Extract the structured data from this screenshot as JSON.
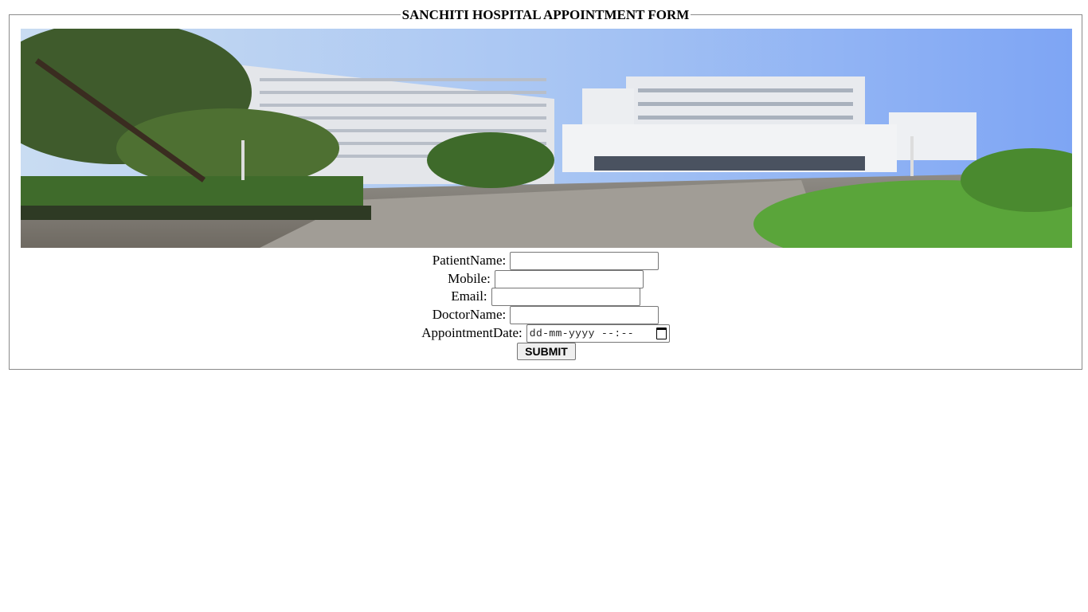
{
  "form": {
    "title": "SANCHITI HOSPITAL APPOINTMENT FORM",
    "fields": [
      {
        "label": "PatientName:",
        "value": ""
      },
      {
        "label": "Mobile:",
        "value": ""
      },
      {
        "label": "Email:",
        "value": ""
      },
      {
        "label": "DoctorName:",
        "value": ""
      },
      {
        "label": "AppointmentDate:",
        "placeholder": "dd-mm-yyyy --:--"
      }
    ],
    "submit_label": "SUBMIT"
  },
  "banner": {
    "icon": "hospital-building-photo"
  }
}
